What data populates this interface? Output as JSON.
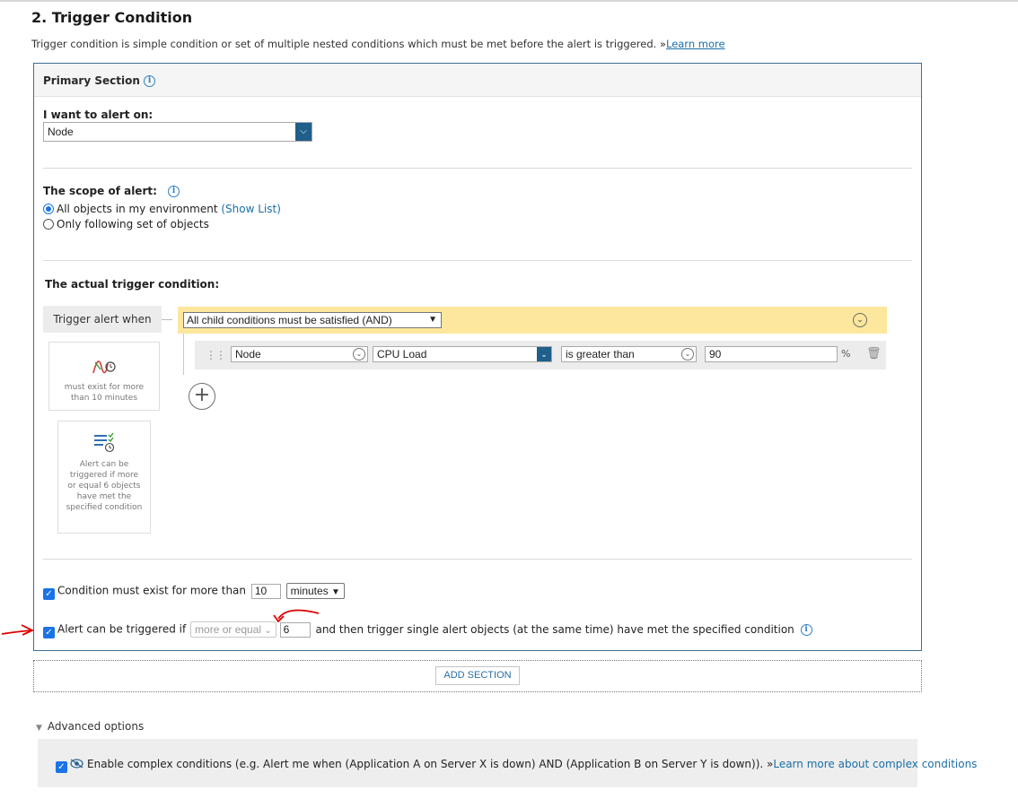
{
  "section_title": "2. Trigger Condition",
  "section_desc": "Trigger condition is simple condition or set of multiple nested conditions which must be met before the alert is triggered. »",
  "learn_more": "Learn more",
  "primary": {
    "title": "Primary Section",
    "alert_on_label": "I want to alert on:",
    "alert_on_value": "Node",
    "scope_label": "The scope of alert:",
    "scope_all": "All objects in my environment",
    "show_list": "(Show List)",
    "scope_only": "Only following set of objects",
    "actual_label": "The actual trigger condition:",
    "trigger_when": "Trigger alert when",
    "and_option": "All child conditions must be satisfied (AND)",
    "condition": {
      "object": "Node",
      "field": "CPU Load",
      "operator": "is greater than",
      "value": "90",
      "unit": "%"
    },
    "card_exist_text": "must exist for more than 10 minutes",
    "card_trigger_text": "Alert can be triggered if more or equal 6 objects have met the specified condition",
    "exist_label": "Condition must exist for more than",
    "exist_value": "10",
    "exist_unit": "minutes",
    "trigger_if_label": "Alert can be triggered if",
    "trigger_if_op": "more or equal",
    "trigger_if_value": "6",
    "trigger_if_tail": "and then trigger single alert objects (at the same time) have met the specified condition"
  },
  "add_section": "ADD SECTION",
  "advanced": {
    "label": "Advanced options",
    "complex_text": "Enable complex conditions (e.g. Alert me when (Application A on Server X is down) AND (Application B on Server Y is down)). »",
    "complex_link": "Learn more about complex conditions"
  },
  "colors": {
    "accent": "#1f5f8a",
    "link": "#1a6fa8",
    "and_bar": "#fde79d",
    "annotation": "#e00000"
  }
}
